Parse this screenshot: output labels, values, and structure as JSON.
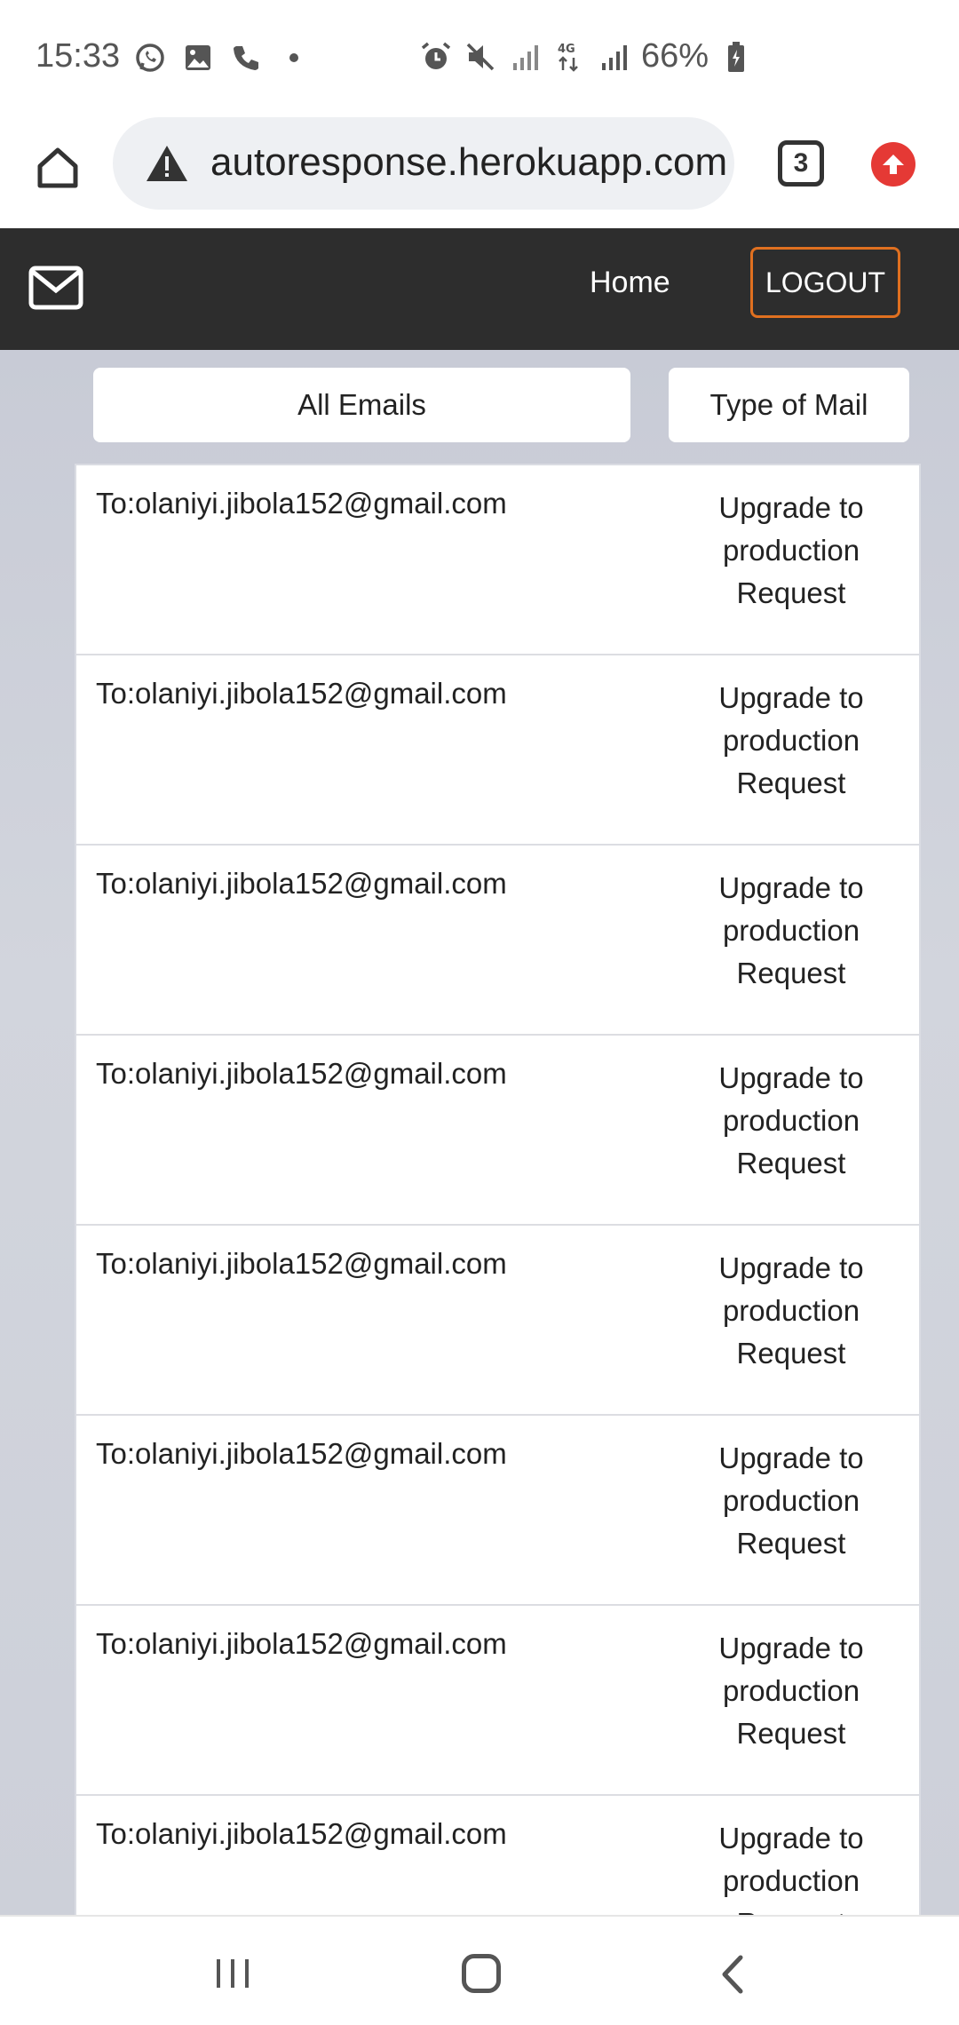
{
  "status_bar": {
    "time": "15:33",
    "battery": "66%",
    "left_icons": [
      "whatsapp-icon",
      "gallery-icon",
      "phone-icon",
      "dot-icon"
    ],
    "right_icons": [
      "alarm-icon",
      "mute-icon",
      "signal-icon",
      "4g-icon",
      "signal-icon",
      "battery-icon"
    ]
  },
  "browser": {
    "url": "autoresponse.herokuapp.com",
    "tab_count": "3"
  },
  "nav": {
    "home_label": "Home",
    "logout_label": "LOGOUT"
  },
  "filters": {
    "all_emails": "All Emails",
    "type_of_mail": "Type of Mail"
  },
  "emails": [
    {
      "to": "To:olaniyi.jibola152@gmail.com",
      "type": "Upgrade to production Request"
    },
    {
      "to": "To:olaniyi.jibola152@gmail.com",
      "type": "Upgrade to production Request"
    },
    {
      "to": "To:olaniyi.jibola152@gmail.com",
      "type": "Upgrade to production Request"
    },
    {
      "to": "To:olaniyi.jibola152@gmail.com",
      "type": "Upgrade to production Request"
    },
    {
      "to": "To:olaniyi.jibola152@gmail.com",
      "type": "Upgrade to production Request"
    },
    {
      "to": "To:olaniyi.jibola152@gmail.com",
      "type": "Upgrade to production Request"
    },
    {
      "to": "To:olaniyi.jibola152@gmail.com",
      "type": "Upgrade to production Request"
    },
    {
      "to": "To:olaniyi.jibola152@gmail.com",
      "type": "Upgrade to production Request"
    }
  ],
  "colors": {
    "nav_bg": "#2d2d2d",
    "logout_border": "#e07020",
    "page_bg": "#c9ccd6"
  }
}
